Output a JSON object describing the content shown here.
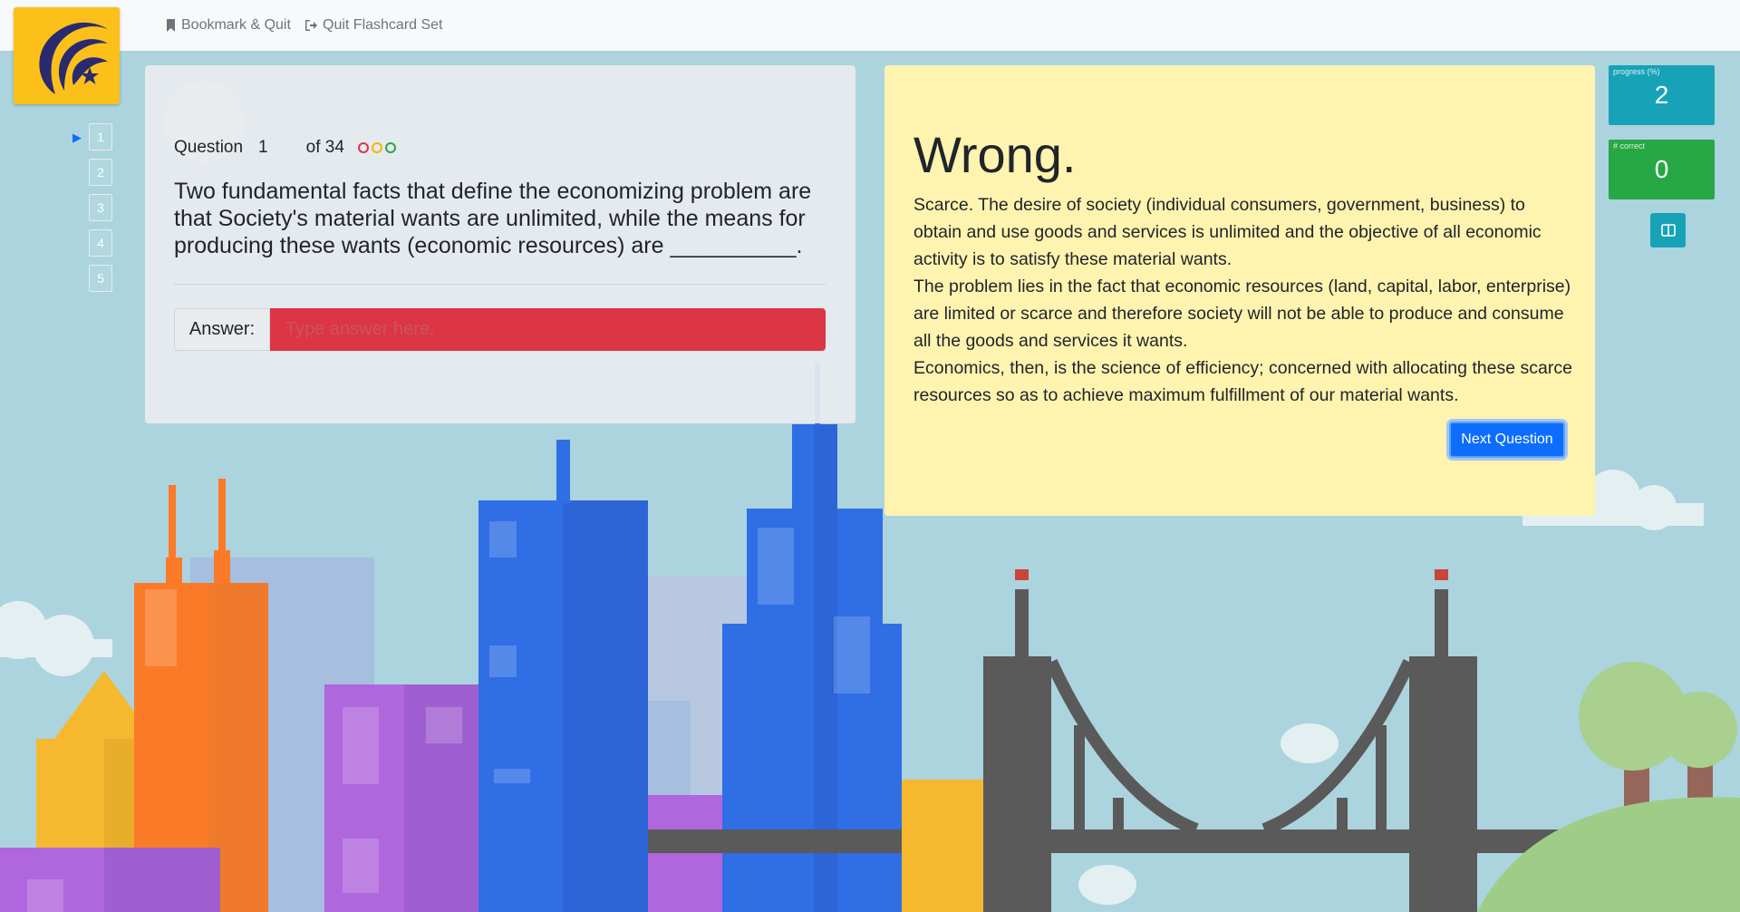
{
  "topbar": {
    "bookmark_label": "Bookmark & Quit",
    "quit_label": "Quit Flashcard Set"
  },
  "pager": {
    "current": 1,
    "items": [
      "1",
      "2",
      "3",
      "4",
      "5"
    ]
  },
  "question": {
    "label": "Question",
    "number": "1",
    "of_label": "of 34",
    "indicator_colors": [
      "#dc3545",
      "#f5b400",
      "#28a745"
    ],
    "text": "Two fundamental facts that define the economizing problem are that Society's material wants are unlimited, while the means for producing these wants (economic resources) are __________.",
    "answer_label": "Answer:",
    "answer_value": "",
    "answer_placeholder": "Type answer here."
  },
  "feedback": {
    "title": "Wrong.",
    "paragraphs": [
      "Scarce. The desire of society (individual consumers, government, business) to obtain and use goods and services is unlimited and the objective of all economic activity is to satisfy these material wants.",
      "The problem lies in the fact that economic resources (land, capital, labor, enterprise) are limited or scarce and therefore society will not be able to produce and consume all the goods and services it wants.",
      "Economics, then, is the science of efficiency; concerned with allocating these scarce resources so as to achieve maximum fulfillment of our material wants."
    ],
    "next_label": "Next Question"
  },
  "stats": {
    "progress_label": "progress (%)",
    "progress_value": "2",
    "correct_label": "# correct",
    "correct_value": "0"
  },
  "colors": {
    "progress_bg": "#17a2b8",
    "correct_bg": "#28a745",
    "answer_error": "#dc3545",
    "feedback_bg": "#fff3b0",
    "logo_bg": "#fcc01b"
  },
  "icons": {
    "bookmark": "bookmark-icon",
    "quit": "sign-out-icon",
    "layout": "columns-icon",
    "pager_current": "caret-right-icon"
  }
}
